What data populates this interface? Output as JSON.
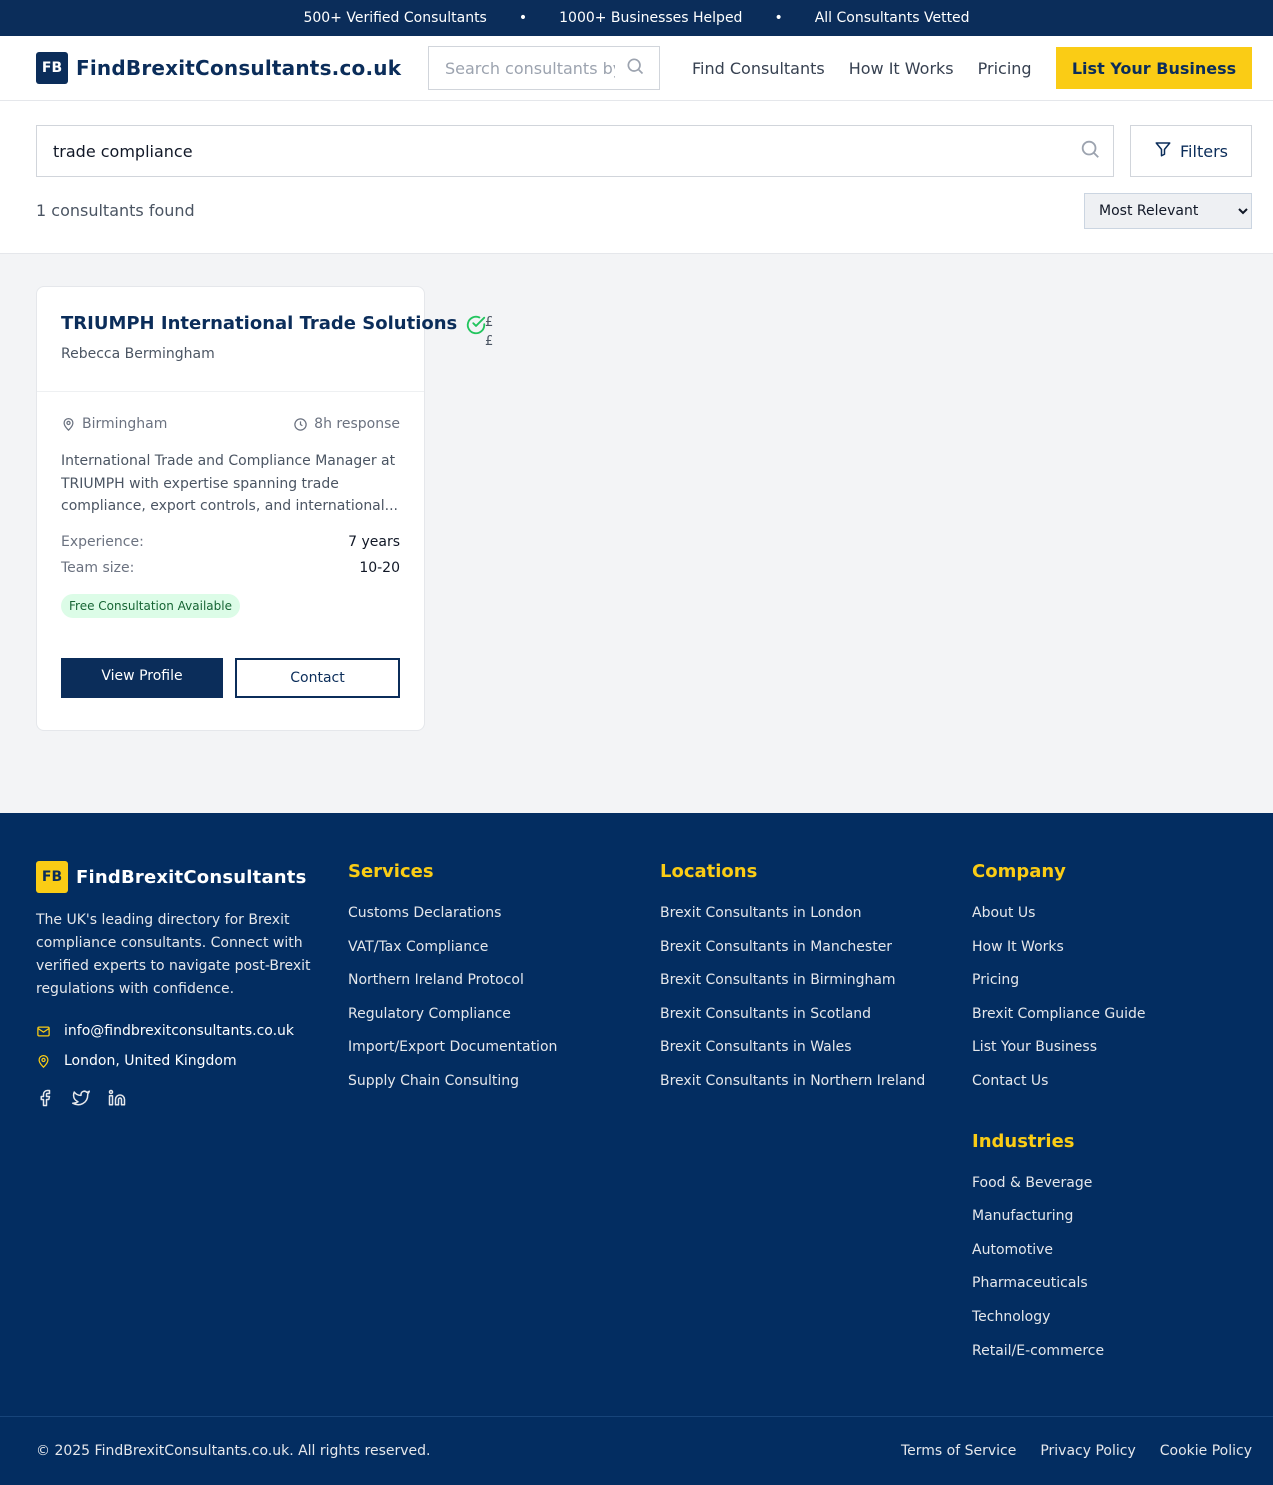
{
  "topbar": {
    "items": [
      "500+ Verified Consultants",
      "1000+ Businesses Helped",
      "All Consultants Vetted"
    ],
    "separator": "•"
  },
  "header": {
    "logo_badge": "FB",
    "logo_text": "FindBrexitConsultants.co.uk",
    "search_placeholder": "Search consultants by name",
    "nav": [
      "Find Consultants",
      "How It Works",
      "Pricing"
    ],
    "cta": "List Your Business"
  },
  "search": {
    "query": "trade compliance",
    "filters_label": "Filters",
    "results_count": "1 consultants found",
    "sort_options": [
      "Most Relevant"
    ],
    "sort_selected": "Most Relevant"
  },
  "results": [
    {
      "name": "TRIUMPH International Trade Solutions",
      "person": "Rebecca Bermingham",
      "price_indicator": "££",
      "location": "Birmingham",
      "response": "8h response",
      "description": "International Trade and Compliance Manager at TRIUMPH with expertise spanning trade compliance, export controls, and international...",
      "experience_label": "Experience:",
      "experience": "7 years",
      "team_label": "Team size:",
      "team": "10-20",
      "badge": "Free Consultation Available",
      "view_label": "View Profile",
      "contact_label": "Contact"
    }
  ],
  "footer": {
    "logo_badge": "FB",
    "logo_text": "FindBrexitConsultants",
    "about": "The UK's leading directory for Brexit compliance consultants. Connect with verified experts to navigate post-Brexit regulations with confidence.",
    "email": "info@findbrexitconsultants.co.uk",
    "address": "London, United Kingdom",
    "services_title": "Services",
    "services": [
      "Customs Declarations",
      "VAT/Tax Compliance",
      "Northern Ireland Protocol",
      "Regulatory Compliance",
      "Import/Export Documentation",
      "Supply Chain Consulting"
    ],
    "locations_title": "Locations",
    "locations": [
      "Brexit Consultants in London",
      "Brexit Consultants in Manchester",
      "Brexit Consultants in Birmingham",
      "Brexit Consultants in Scotland",
      "Brexit Consultants in Wales",
      "Brexit Consultants in Northern Ireland"
    ],
    "company_title": "Company",
    "company": [
      "About Us",
      "How It Works",
      "Pricing",
      "Brexit Compliance Guide",
      "List Your Business",
      "Contact Us"
    ],
    "industries_title": "Industries",
    "industries": [
      "Food & Beverage",
      "Manufacturing",
      "Automotive",
      "Pharmaceuticals",
      "Technology",
      "Retail/E-commerce"
    ],
    "copyright": "© 2025 FindBrexitConsultants.co.uk. All rights reserved.",
    "legal": [
      "Terms of Service",
      "Privacy Policy",
      "Cookie Policy"
    ]
  },
  "colors": {
    "navy": "#0b2d5a",
    "footer_navy": "#032d61",
    "accent_yellow": "#facc15",
    "verified_green": "#22c55e",
    "badge_bg": "#dcfce7"
  },
  "icons": {
    "search": "search-icon",
    "filter": "filter-icon",
    "verified": "check-circle-icon",
    "location": "map-pin-icon",
    "clock": "clock-icon",
    "email": "mail-icon",
    "social": [
      "facebook-icon",
      "twitter-icon",
      "linkedin-icon"
    ]
  }
}
